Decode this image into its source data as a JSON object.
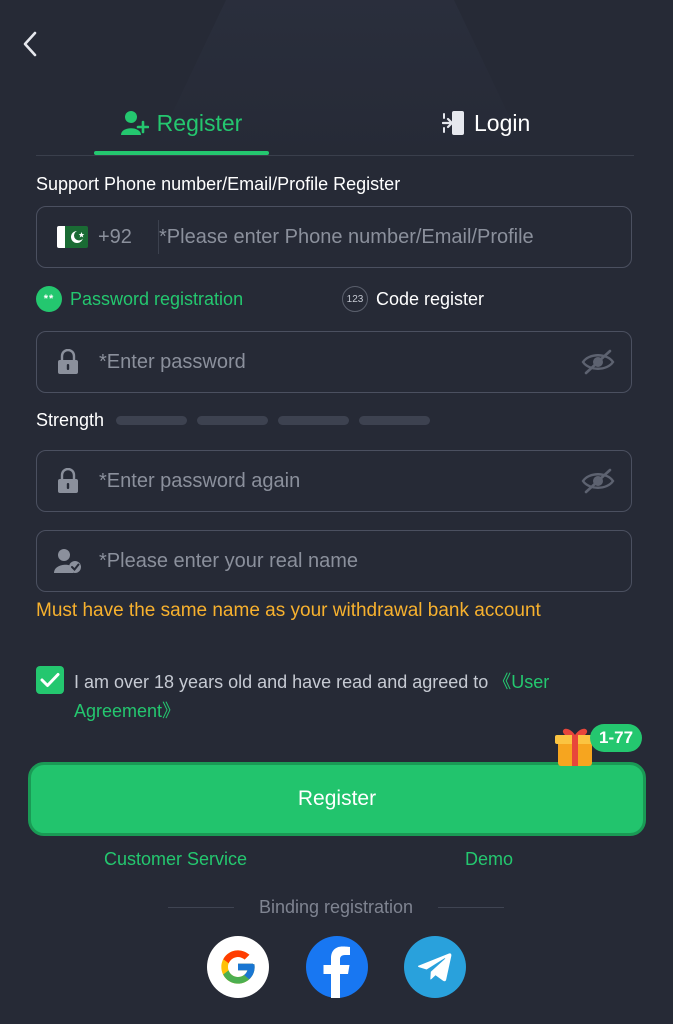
{
  "tabs": {
    "register_label": "Register",
    "login_label": "Login"
  },
  "form": {
    "section_label": "Support Phone number/Email/Profile Register",
    "country_code": "+92",
    "required_mark": "*",
    "phone_placeholder": "Please enter Phone number/Email/Profile",
    "modes": {
      "password_label": "Password registration",
      "password_dot": "**",
      "code_label": "Code register",
      "code_icon_text": "123"
    },
    "password_placeholder": "Enter password",
    "strength_label": "Strength",
    "password_again_placeholder": "Enter password again",
    "real_name_placeholder": "Please enter your real name",
    "name_warning": "Must have the same name as your withdrawal bank account"
  },
  "agreement": {
    "text": "I am over 18 years old and have read and agreed to ",
    "link": "《User Agreement》",
    "checked": true
  },
  "register_button": {
    "label": "Register",
    "gift_badge": "1-77"
  },
  "links": {
    "customer_service": "Customer Service",
    "demo": "Demo"
  },
  "binding": {
    "label": "Binding registration",
    "providers": [
      "google-icon",
      "facebook-icon",
      "telegram-icon"
    ]
  },
  "colors": {
    "background": "#262a36",
    "accent": "#24c76f",
    "warning": "#f7b12e",
    "required": "#e0435f"
  }
}
